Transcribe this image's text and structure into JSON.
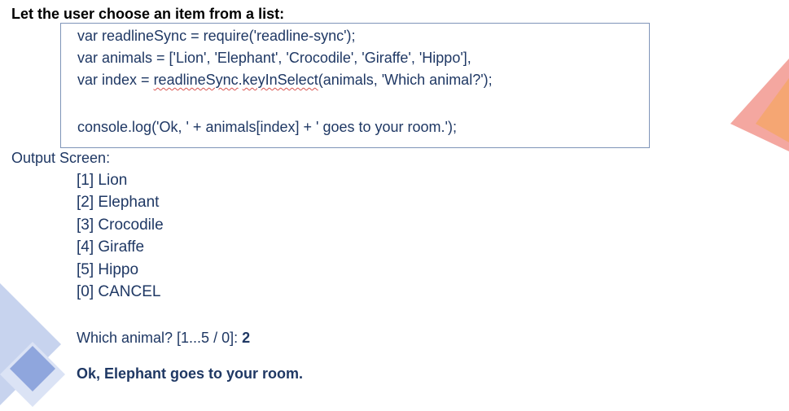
{
  "heading": "Let the user choose an item from a list:",
  "code": {
    "line1": "var readlineSync = require('readline-sync');",
    "line2": "var animals = ['Lion', 'Elephant', 'Crocodile', 'Giraffe', 'Hippo'],",
    "line3_prefix": "var index = ",
    "line3_method_a": "readlineSync",
    "line3_dot": ".",
    "line3_method_b": "keyInSelect",
    "line3_suffix": "(animals, 'Which animal?');",
    "line4": "console.log('Ok, ' + animals[index] + ' goes to your room.');"
  },
  "output": {
    "title": "Output Screen:",
    "options": [
      "[1] Lion",
      "[2] Elephant",
      "[3] Crocodile",
      "[4] Giraffe",
      "[5] Hippo",
      "[0] CANCEL"
    ],
    "prompt": "Which animal? [1...5 / 0]: ",
    "answer": "2",
    "result": "Ok, Elephant goes to your room."
  },
  "colors": {
    "text": "#1f3864",
    "box_border": "#7f94b8",
    "deco_pink": "#f4a7a0",
    "deco_orange": "#f4a66b",
    "deco_blue_light": "#c7d3ee",
    "deco_blue": "#8fa6dd"
  }
}
